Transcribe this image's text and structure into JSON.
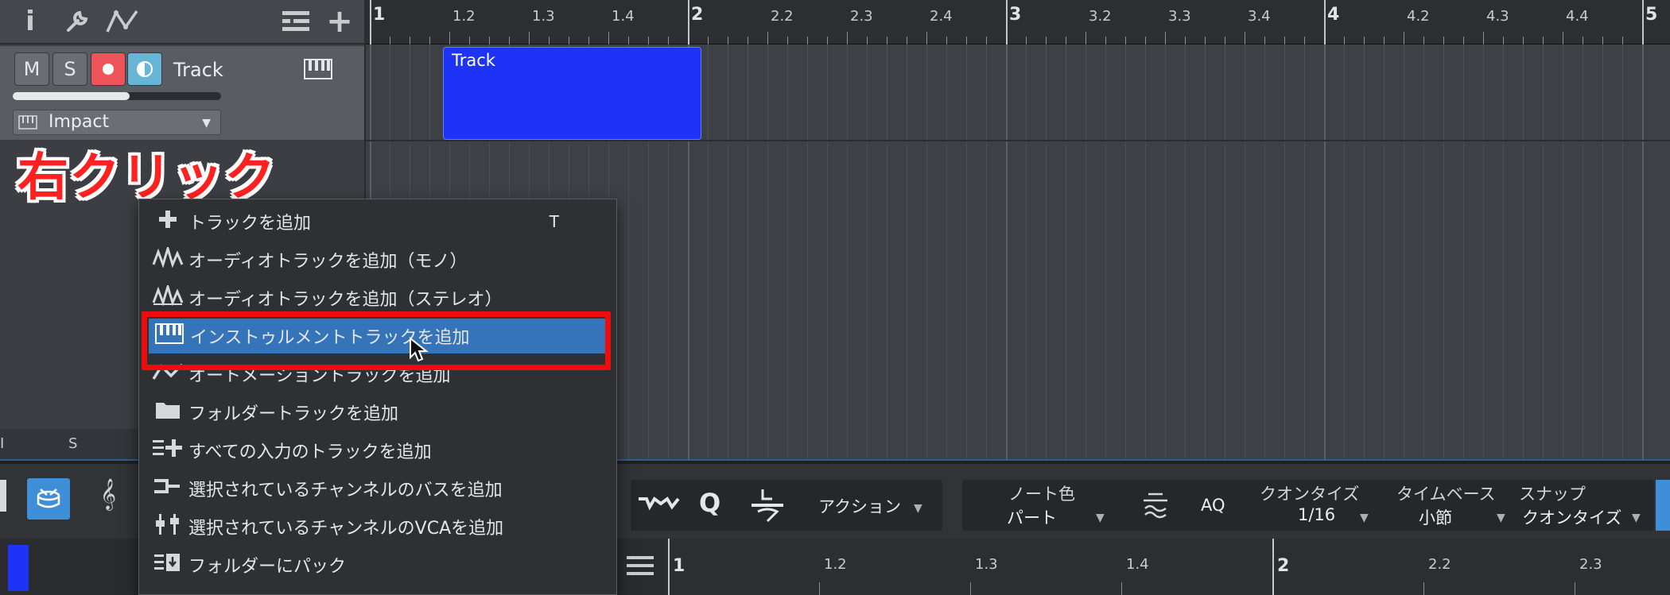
{
  "toolbar": {
    "info": "i",
    "add": "+"
  },
  "track": {
    "mute": "M",
    "solo": "S",
    "name": "Track",
    "instrument": "Impact",
    "volume_fraction": 0.56,
    "colors": {
      "record": "#f0545b",
      "monitor": "#67b6d8",
      "clip": "#1d33f5"
    }
  },
  "ruler": {
    "labels": [
      "1",
      "1.2",
      "1.3",
      "1.4",
      "2",
      "2.2",
      "2.3",
      "2.4",
      "3",
      "3.2",
      "3.3",
      "3.4",
      "4",
      "4.2",
      "4.3",
      "4.4",
      "5"
    ]
  },
  "clip": {
    "label": "Track"
  },
  "annotation": "右クリック",
  "left_strip": {
    "col1": "I",
    "col2": "S"
  },
  "menu": {
    "items": [
      {
        "icon": "plus-icon",
        "label": "トラックを追加",
        "shortcut": "T"
      },
      {
        "icon": "audio-mono-icon",
        "label": "オーディオトラックを追加（モノ）"
      },
      {
        "icon": "audio-stereo-icon",
        "label": "オーディオトラックを追加（ステレオ）"
      },
      {
        "icon": "keyboard-icon",
        "label": "インストゥルメントトラックを追加",
        "active": true
      },
      {
        "icon": "automation-icon",
        "label": "オートメーショントラックを追加"
      },
      {
        "icon": "folder-icon",
        "label": "フォルダートラックを追加"
      },
      {
        "icon": "all-inputs-icon",
        "label": "すべての入力のトラックを追加"
      },
      {
        "icon": "bus-icon",
        "label": "選択されているチャンネルのバスを追加"
      },
      {
        "icon": "vca-icon",
        "label": "選択されているチャンネルのVCAを追加"
      },
      {
        "icon": "pack-folder-icon",
        "label": "フォルダーにパック"
      }
    ]
  },
  "editor": {
    "action_label": "アクション",
    "aq_label": "AQ",
    "note_color_label": "ノート色",
    "note_color_value": "パート",
    "quantize_label": "クオンタイズ",
    "quantize_value": "1/16",
    "timebase_label": "タイムベース",
    "timebase_value": "小節",
    "snap_label": "スナップ",
    "snap_value": "クオンタイズ",
    "q_label": "Q",
    "ruler_labels": [
      "1",
      "1.2",
      "1.3",
      "1.4",
      "2",
      "2.2",
      "2.3"
    ]
  }
}
